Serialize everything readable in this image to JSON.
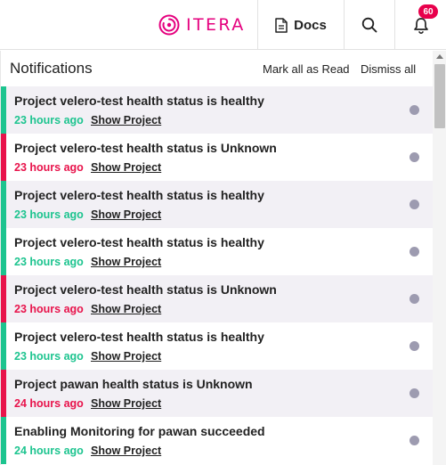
{
  "brand": {
    "name": "ITERA",
    "color": "#e5007e"
  },
  "header": {
    "docs_label": "Docs",
    "notification_count": "60"
  },
  "panel": {
    "title": "Notifications",
    "mark_all_read": "Mark all as Read",
    "dismiss_all": "Dismiss all"
  },
  "colors": {
    "healthy": "#1dc48f",
    "unknown": "#e8134b",
    "badge": "#e8004c",
    "unread_dot": "#9d9bb0"
  },
  "notifications": [
    {
      "title": "Project velero-test health status is healthy",
      "time": "23 hours ago",
      "link": "Show Project",
      "status": "healthy"
    },
    {
      "title": "Project velero-test health status is Unknown",
      "time": "23 hours ago",
      "link": "Show Project",
      "status": "unknown"
    },
    {
      "title": "Project velero-test health status is healthy",
      "time": "23 hours ago",
      "link": "Show Project",
      "status": "healthy"
    },
    {
      "title": "Project velero-test health status is healthy",
      "time": "23 hours ago",
      "link": "Show Project",
      "status": "healthy"
    },
    {
      "title": "Project velero-test health status is Unknown",
      "time": "23 hours ago",
      "link": "Show Project",
      "status": "unknown"
    },
    {
      "title": "Project velero-test health status is healthy",
      "time": "23 hours ago",
      "link": "Show Project",
      "status": "healthy"
    },
    {
      "title": "Project pawan health status is Unknown",
      "time": "24 hours ago",
      "link": "Show Project",
      "status": "unknown"
    },
    {
      "title": "Enabling Monitoring for pawan succeeded",
      "time": "24 hours ago",
      "link": "Show Project",
      "status": "healthy"
    }
  ]
}
